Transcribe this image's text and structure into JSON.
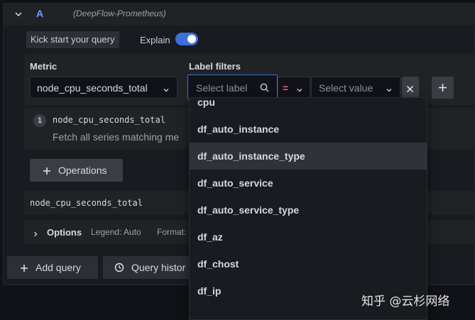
{
  "query": {
    "letter": "A",
    "datasource": "(DeepFlow-Prometheus)"
  },
  "toolbar": {
    "kickstart_label": "Kick start your query",
    "explain_label": "Explain",
    "explain_enabled": true
  },
  "metric": {
    "label": "Metric",
    "value": "node_cpu_seconds_total"
  },
  "label_filters": {
    "label": "Label filters",
    "label_placeholder": "Select label",
    "operator": "=",
    "value_placeholder": "Select value"
  },
  "explain_step": {
    "number": "1",
    "title": "node_cpu_seconds_total",
    "description": "Fetch all series matching me"
  },
  "operations_label": "Operations",
  "query_preview": "node_cpu_seconds_total",
  "options": {
    "label": "Options",
    "legend": "Legend: Auto",
    "format": "Format:"
  },
  "bottom": {
    "add_query": "Add query",
    "query_history": "Query histor"
  },
  "dropdown": {
    "items": [
      "cpu",
      "df_auto_instance",
      "df_auto_instance_type",
      "df_auto_service",
      "df_auto_service_type",
      "df_az",
      "df_chost",
      "df_ip"
    ],
    "selected_index": 2
  },
  "watermark": "知乎 @云杉网络",
  "colors": {
    "accent": "#3d71d9",
    "query_letter": "#6e9fff",
    "operator": "#ff5286",
    "toggle": "#3d71d9"
  }
}
